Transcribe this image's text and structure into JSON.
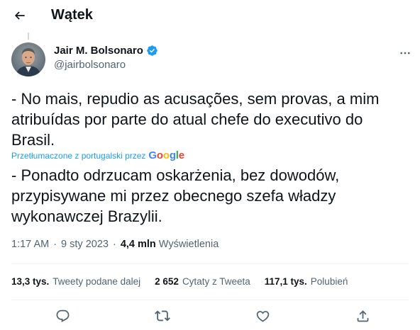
{
  "header": {
    "title": "Wątek",
    "back_icon": "arrow-left-icon"
  },
  "author": {
    "name": "Jair M. Bolsonaro",
    "handle": "@jairbolsonaro",
    "verified_icon": "verified-badge-icon",
    "verified_color": "#1d9bf0"
  },
  "tweet": {
    "original_text": "- No mais, repudio as acusações, sem provas, a mim atribuídas por parte do atual chefe do executivo do Brasil.",
    "translation_note": "Przetłumaczone z portugalski przez",
    "translation_provider": "Google",
    "translated_text": "- Ponadto odrzucam oskarżenia, bez dowodów, przypisywane mi przez obecnego szefa władzy wykonawczej Brazylii."
  },
  "meta": {
    "time": "1:17 AM",
    "separator": "·",
    "date": "9 sty 2023",
    "views_count": "4,4 mln",
    "views_label": "Wyświetlenia"
  },
  "stats": {
    "retweets_count": "13,3 tys.",
    "retweets_label": "Tweety podane dalej",
    "quotes_count": "2 652",
    "quotes_label": "Cytaty z Tweeta",
    "likes_count": "117,1 tys.",
    "likes_label": "Polubień"
  },
  "actions": [
    "reply-icon",
    "retweet-icon",
    "like-icon",
    "share-icon"
  ],
  "colors": {
    "accent": "#1d9bf0",
    "text_primary": "#0f1419",
    "text_secondary": "#536471",
    "divider": "#eff3f4"
  }
}
